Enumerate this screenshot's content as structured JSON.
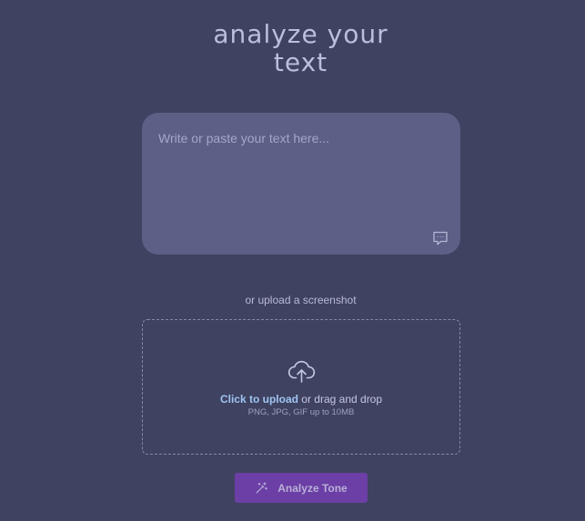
{
  "header": {
    "title_line1": "analyze your",
    "title_line2": "text"
  },
  "text_input": {
    "placeholder": "Write or paste your text here...",
    "value": "",
    "icon": "chat-bubble-icon"
  },
  "upload": {
    "divider_label": "or upload a screenshot",
    "icon": "cloud-upload-icon",
    "link_label": "Click to upload",
    "drag_label": " or drag and drop",
    "hint": "PNG, JPG, GIF up to 10MB"
  },
  "actions": {
    "analyze_label": "Analyze Tone",
    "analyze_icon": "magic-wand-icon"
  },
  "colors": {
    "background": "#3f4260",
    "textarea": "#5d5f86",
    "link": "#9fc4f2",
    "button": "#6b3fa6"
  }
}
